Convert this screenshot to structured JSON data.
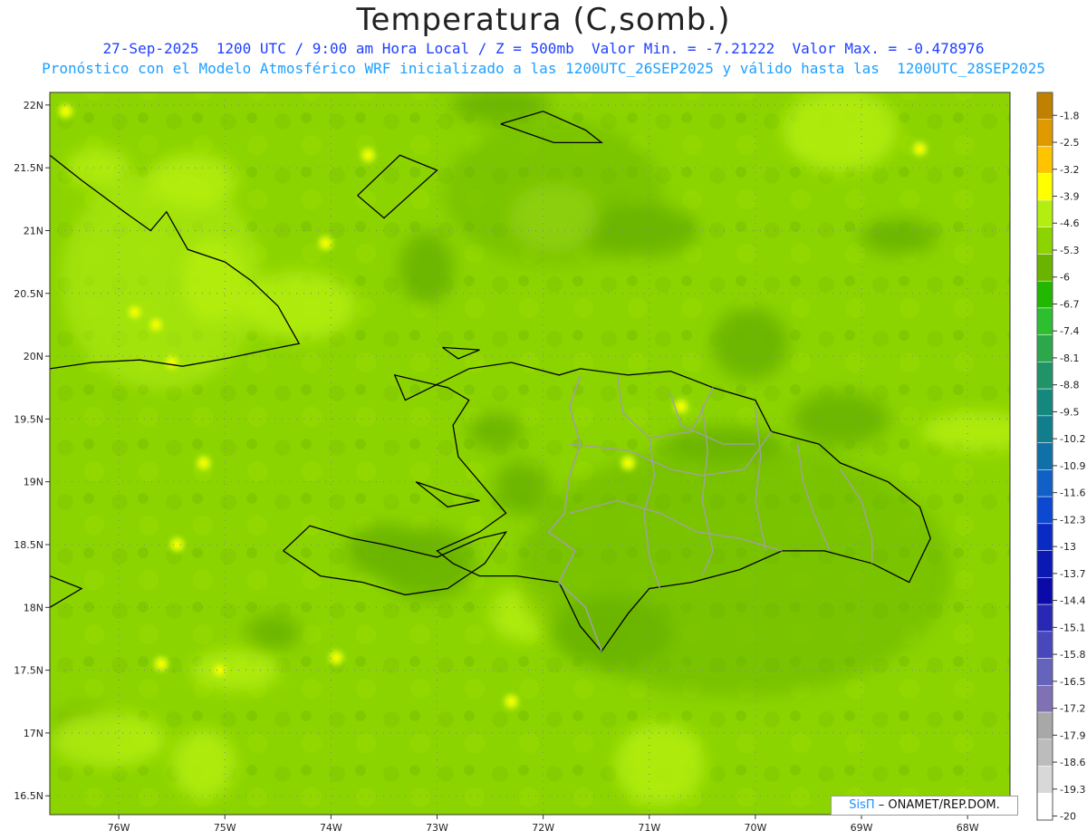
{
  "title": "Temperatura (C,somb.)",
  "subtitle1": "27-Sep-2025  1200 UTC / 9:00 am Hora Local / Z = 500mb  Valor Min. = -7.21222  Valor Max. = -0.478976",
  "subtitle2": "Pronóstico con el Modelo Atmosférico WRF inicializado a las 1200UTC_26SEP2025 y válido hasta las  1200UTC_28SEP2025",
  "credit": {
    "brand": "SisΠ",
    "text": " – ONAMET/REP.DOM."
  },
  "axes": {
    "lat_labels": [
      "22N",
      "21.5N",
      "21N",
      "20.5N",
      "20N",
      "19.5N",
      "19N",
      "18.5N",
      "18N",
      "17.5N",
      "17N",
      "16.5N"
    ],
    "lon_labels": [
      "76W",
      "75W",
      "74W",
      "73W",
      "72W",
      "71W",
      "70W",
      "69W",
      "68W"
    ],
    "lat_range": [
      16.35,
      22.1
    ],
    "lon_range": [
      -76.65,
      -67.6
    ]
  },
  "colorbar": {
    "labels": [
      "-1.8",
      "-2.5",
      "-3.2",
      "-3.9",
      "-4.6",
      "-5.3",
      "-6",
      "-6.7",
      "-7.4",
      "-8.1",
      "-8.8",
      "-9.5",
      "-10.2",
      "-10.9",
      "-11.6",
      "-12.3",
      "-13",
      "-13.7",
      "-14.4",
      "-15.1",
      "-15.8",
      "-16.5",
      "-17.2",
      "-17.9",
      "-18.6",
      "-19.3",
      "-20"
    ],
    "colors": [
      "#c08000",
      "#e09a00",
      "#ffc400",
      "#ffff00",
      "#b4ee10",
      "#8cd400",
      "#6ab400",
      "#22b800",
      "#2cc030",
      "#2ca84a",
      "#1e9468",
      "#14887c",
      "#107e8c",
      "#1070a8",
      "#1060c8",
      "#0c48d0",
      "#0a2ac4",
      "#0a18b4",
      "#0a0aa8",
      "#2828b4",
      "#4848bc",
      "#6464bc",
      "#8070b4",
      "#a8a8a8",
      "#bcbcbc",
      "#d8d8d8",
      "#ffffff"
    ]
  },
  "colors": {
    "field_base": "#8cd400",
    "field_dark": "#6ab400",
    "field_light": "#b4ee10",
    "warm_spot": "#ffff00",
    "coast": "#000000",
    "province_border": "#a0a0a0"
  },
  "map": {
    "coast_cuba": [
      [
        -76.65,
        21.6
      ],
      [
        -76.35,
        21.4
      ],
      [
        -75.95,
        21.15
      ],
      [
        -75.7,
        21.0
      ],
      [
        -75.55,
        21.15
      ],
      [
        -75.35,
        20.85
      ],
      [
        -75.0,
        20.75
      ],
      [
        -74.75,
        20.6
      ],
      [
        -74.5,
        20.4
      ],
      [
        -74.3,
        20.1
      ],
      [
        -74.6,
        20.05
      ],
      [
        -75.0,
        19.98
      ],
      [
        -75.4,
        19.92
      ],
      [
        -75.8,
        19.97
      ],
      [
        -76.25,
        19.95
      ],
      [
        -76.65,
        19.9
      ]
    ],
    "coast_inagua": [
      [
        -73.75,
        21.28
      ],
      [
        -73.35,
        21.6
      ],
      [
        -73.0,
        21.48
      ],
      [
        -73.5,
        21.1
      ],
      [
        -73.75,
        21.28
      ]
    ],
    "coast_caicos": [
      [
        -72.4,
        21.85
      ],
      [
        -72.0,
        21.95
      ],
      [
        -71.6,
        21.8
      ],
      [
        -71.45,
        21.7
      ],
      [
        -71.9,
        21.7
      ],
      [
        -72.4,
        21.85
      ]
    ],
    "coast_hispaniola": [
      [
        -74.45,
        18.45
      ],
      [
        -74.2,
        18.65
      ],
      [
        -73.8,
        18.55
      ],
      [
        -73.5,
        18.5
      ],
      [
        -73.0,
        18.4
      ],
      [
        -72.6,
        18.55
      ],
      [
        -72.35,
        18.6
      ],
      [
        -72.55,
        18.35
      ],
      [
        -72.9,
        18.15
      ],
      [
        -73.3,
        18.1
      ],
      [
        -73.7,
        18.2
      ],
      [
        -74.1,
        18.25
      ],
      [
        -74.45,
        18.45
      ]
    ],
    "coast_hispaniola_main": [
      [
        -72.7,
        19.9
      ],
      [
        -72.3,
        19.95
      ],
      [
        -71.85,
        19.85
      ],
      [
        -71.65,
        19.9
      ],
      [
        -71.2,
        19.85
      ],
      [
        -70.8,
        19.88
      ],
      [
        -70.4,
        19.75
      ],
      [
        -70.0,
        19.65
      ],
      [
        -69.85,
        19.4
      ],
      [
        -69.4,
        19.3
      ],
      [
        -69.2,
        19.15
      ],
      [
        -68.75,
        19.0
      ],
      [
        -68.45,
        18.8
      ],
      [
        -68.35,
        18.55
      ],
      [
        -68.55,
        18.2
      ],
      [
        -68.9,
        18.35
      ],
      [
        -69.35,
        18.45
      ],
      [
        -69.75,
        18.45
      ],
      [
        -70.15,
        18.3
      ],
      [
        -70.6,
        18.2
      ],
      [
        -71.0,
        18.15
      ],
      [
        -71.2,
        17.95
      ],
      [
        -71.45,
        17.65
      ],
      [
        -71.65,
        17.85
      ],
      [
        -71.85,
        18.2
      ],
      [
        -72.25,
        18.25
      ],
      [
        -72.6,
        18.25
      ],
      [
        -72.85,
        18.35
      ],
      [
        -73.0,
        18.45
      ],
      [
        -72.6,
        18.6
      ],
      [
        -72.35,
        18.75
      ],
      [
        -72.6,
        19.0
      ],
      [
        -72.8,
        19.2
      ],
      [
        -72.85,
        19.45
      ],
      [
        -72.7,
        19.65
      ],
      [
        -72.9,
        19.75
      ],
      [
        -73.4,
        19.85
      ],
      [
        -73.3,
        19.65
      ],
      [
        -72.7,
        19.9
      ]
    ],
    "coast_gonave": [
      [
        -73.2,
        19.0
      ],
      [
        -72.85,
        18.9
      ],
      [
        -72.6,
        18.85
      ],
      [
        -72.9,
        18.8
      ],
      [
        -73.2,
        19.0
      ]
    ],
    "coast_tortuga": [
      [
        -72.95,
        20.07
      ],
      [
        -72.6,
        20.05
      ],
      [
        -72.8,
        19.98
      ],
      [
        -72.95,
        20.07
      ]
    ],
    "coast_jamaica": [
      [
        -76.65,
        18.25
      ],
      [
        -76.35,
        18.15
      ],
      [
        -76.65,
        18.0
      ]
    ],
    "dr_border": [
      [
        -71.65,
        19.85
      ],
      [
        -71.75,
        19.6
      ],
      [
        -71.65,
        19.3
      ],
      [
        -71.75,
        19.05
      ],
      [
        -71.8,
        18.75
      ],
      [
        -71.95,
        18.6
      ],
      [
        -71.7,
        18.45
      ],
      [
        -71.85,
        18.2
      ],
      [
        -71.6,
        18.0
      ],
      [
        -71.45,
        17.65
      ]
    ],
    "provinces": [
      [
        [
          -71.3,
          19.85
        ],
        [
          -71.25,
          19.55
        ],
        [
          -71.0,
          19.35
        ],
        [
          -70.6,
          19.4
        ],
        [
          -70.4,
          19.75
        ]
      ],
      [
        [
          -71.75,
          19.3
        ],
        [
          -71.2,
          19.25
        ],
        [
          -70.8,
          19.1
        ],
        [
          -70.5,
          19.05
        ],
        [
          -70.1,
          19.1
        ],
        [
          -69.85,
          19.4
        ]
      ],
      [
        [
          -71.75,
          18.75
        ],
        [
          -71.3,
          18.85
        ],
        [
          -70.9,
          18.75
        ],
        [
          -70.55,
          18.6
        ],
        [
          -70.15,
          18.55
        ],
        [
          -69.75,
          18.45
        ]
      ],
      [
        [
          -71.0,
          19.35
        ],
        [
          -70.95,
          19.05
        ],
        [
          -71.05,
          18.75
        ],
        [
          -71.0,
          18.4
        ],
        [
          -70.9,
          18.15
        ]
      ],
      [
        [
          -70.5,
          19.6
        ],
        [
          -70.45,
          19.25
        ],
        [
          -70.5,
          18.85
        ],
        [
          -70.4,
          18.45
        ],
        [
          -70.5,
          18.25
        ]
      ],
      [
        [
          -70.0,
          19.6
        ],
        [
          -69.95,
          19.2
        ],
        [
          -70.0,
          18.85
        ],
        [
          -69.9,
          18.45
        ]
      ],
      [
        [
          -69.6,
          19.3
        ],
        [
          -69.55,
          19.0
        ],
        [
          -69.45,
          18.75
        ],
        [
          -69.3,
          18.45
        ]
      ],
      [
        [
          -69.2,
          19.1
        ],
        [
          -69.0,
          18.85
        ],
        [
          -68.9,
          18.55
        ],
        [
          -68.9,
          18.35
        ]
      ],
      [
        [
          -70.8,
          19.7
        ],
        [
          -70.7,
          19.45
        ],
        [
          -70.3,
          19.3
        ],
        [
          -70.0,
          19.3
        ]
      ]
    ],
    "warm_spots": [
      [
        -76.5,
        21.95
      ],
      [
        -75.85,
        20.35
      ],
      [
        -75.65,
        20.25
      ],
      [
        -75.5,
        19.95
      ],
      [
        -74.05,
        20.9
      ],
      [
        -73.65,
        21.6
      ],
      [
        -75.2,
        19.15
      ],
      [
        -75.45,
        18.5
      ],
      [
        -75.6,
        17.55
      ],
      [
        -75.05,
        17.5
      ],
      [
        -73.95,
        17.6
      ],
      [
        -71.2,
        19.15
      ],
      [
        -70.7,
        19.6
      ],
      [
        -68.45,
        21.65
      ],
      [
        -72.3,
        17.25
      ]
    ],
    "dark_blobs": [
      [
        -72.45,
        19.4
      ],
      [
        -73.5,
        18.45
      ],
      [
        -73.1,
        18.35
      ],
      [
        -70.3,
        19.3
      ],
      [
        -72.2,
        18.95
      ],
      [
        -70.05,
        20.1
      ],
      [
        -72.4,
        22.0
      ],
      [
        -71.1,
        21.0
      ],
      [
        -73.1,
        20.7
      ],
      [
        -68.65,
        20.95
      ],
      [
        -69.2,
        19.5
      ],
      [
        -71.35,
        17.8
      ],
      [
        -74.55,
        17.8
      ],
      [
        -76.3,
        17.0
      ]
    ],
    "light_blobs": [
      [
        -76.2,
        21.5
      ],
      [
        -75.3,
        21.4
      ],
      [
        -74.3,
        20.4
      ],
      [
        -75.1,
        20.6
      ],
      [
        -74.9,
        17.5
      ],
      [
        -76.1,
        16.95
      ],
      [
        -75.2,
        16.75
      ],
      [
        -70.9,
        16.75
      ],
      [
        -67.9,
        19.4
      ],
      [
        -72.2,
        17.95
      ],
      [
        -71.9,
        21.1
      ],
      [
        -69.2,
        21.8
      ]
    ]
  }
}
